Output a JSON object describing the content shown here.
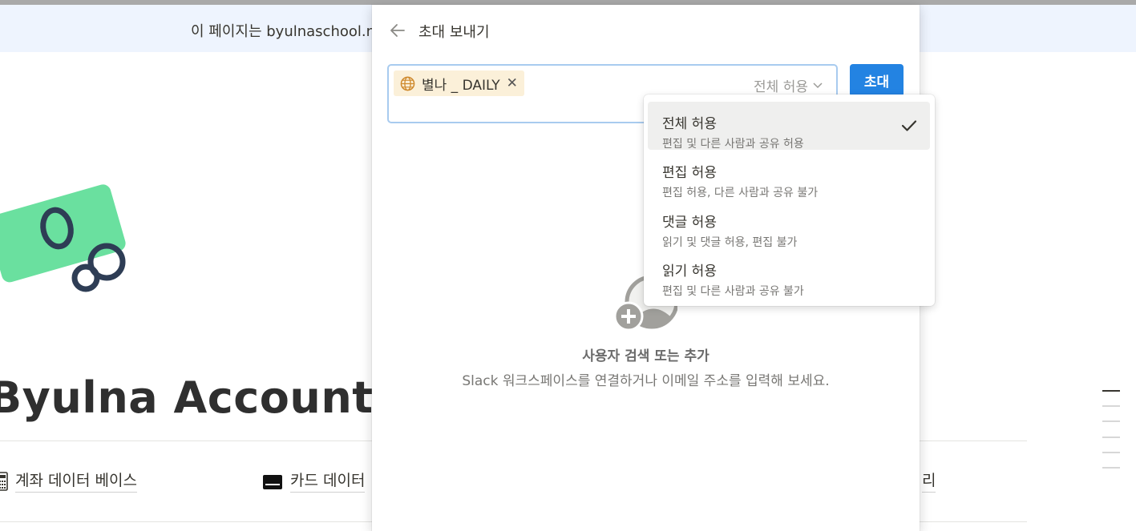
{
  "banner": {
    "text": "이 페이지는 byulnaschool.no"
  },
  "page": {
    "title": "Byulna Account Bo",
    "links": [
      {
        "label": "계좌 데이터 베이스"
      },
      {
        "label": "카드 데이터"
      },
      {
        "label": "리"
      }
    ]
  },
  "modal": {
    "title": "초대 보내기",
    "chip": {
      "label": "별나 _ DAILY"
    },
    "permission": {
      "selected": "전체 허용"
    },
    "invite_label": "초대",
    "empty_state": {
      "title": "사용자 검색 또는 추가",
      "description": "Slack 워크스페이스를 연결하거나 이메일 주소를 입력해 보세요."
    }
  },
  "dropdown": {
    "options": [
      {
        "label": "전체 허용",
        "desc": "편집 및 다른 사람과 공유 허용",
        "selected": true
      },
      {
        "label": "편집 허용",
        "desc": "편집 허용, 다른 사람과 공유 불가",
        "selected": false
      },
      {
        "label": "댓글 허용",
        "desc": "읽기 및 댓글 허용, 편집 불가",
        "selected": false
      },
      {
        "label": "읽기 허용",
        "desc": "편집 및 다른 사람과 공유 불가",
        "selected": false
      }
    ]
  },
  "colors": {
    "accent": "#2383e2",
    "chip_bg": "#fbf0d9",
    "banner_bg": "#eef4fe",
    "cover_green": "#6ae09f",
    "cover_navy": "#2e3d55"
  },
  "icons": [
    "back-arrow-icon",
    "globe-icon",
    "close-icon",
    "chevron-down-icon",
    "add-user-icon",
    "checkmark-icon",
    "calculator-icon",
    "credit-card-icon"
  ]
}
